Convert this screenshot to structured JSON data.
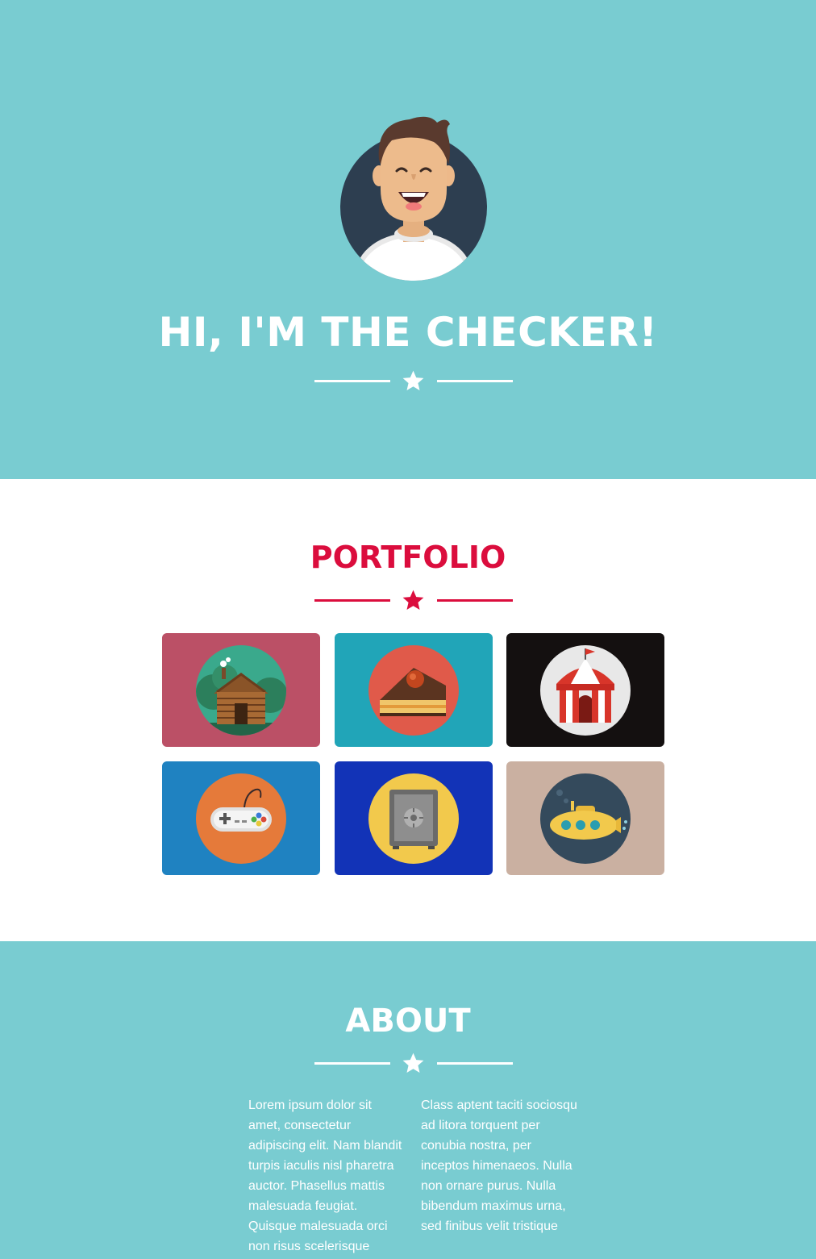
{
  "hero": {
    "title": "HI, I'M THE CHECKER!",
    "bg_color": "#79ccd1",
    "avatar_icon": "smiling-man-avatar-icon"
  },
  "portfolio": {
    "title": "PORTFOLIO",
    "accent_color": "#db0d3d",
    "items": [
      {
        "name": "cabin",
        "icon": "log-cabin-icon",
        "bg": "#bb5066"
      },
      {
        "name": "cake",
        "icon": "cake-slice-icon",
        "bg": "#21a5b8"
      },
      {
        "name": "circus",
        "icon": "circus-tent-icon",
        "bg": "#141010"
      },
      {
        "name": "game",
        "icon": "game-controller-icon",
        "bg": "#1f82c1"
      },
      {
        "name": "safe",
        "icon": "safe-icon",
        "bg": "#1233b7"
      },
      {
        "name": "submarine",
        "icon": "submarine-icon",
        "bg": "#cab0a1"
      }
    ]
  },
  "about": {
    "title": "ABOUT",
    "col1": "Lorem ipsum dolor sit amet, consectetur adipiscing elit. Nam blandit turpis iaculis nisl pharetra auctor. Phasellus mattis malesuada feugiat. Quisque malesuada orci non risus scelerisque",
    "col2": "Class aptent taciti sociosqu ad litora torquent per conubia nostra, per inceptos himenaeos. Nulla non ornare purus. Nulla bibendum maximus urna, sed finibus velit tristique"
  }
}
